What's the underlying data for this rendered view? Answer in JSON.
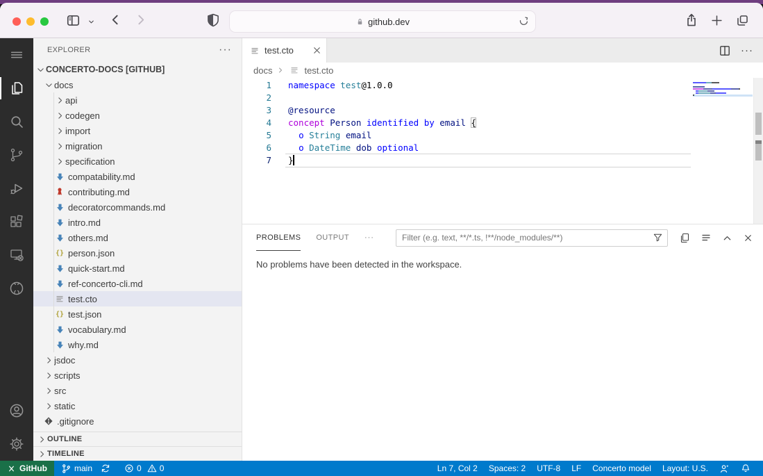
{
  "browser": {
    "url": "github.dev",
    "traffic_lights": [
      "close",
      "minimize",
      "zoom"
    ],
    "toolbar_icons": [
      "sidebar-toggle",
      "tab-overview-chevron",
      "back",
      "forward",
      "privacy-shield",
      "reload",
      "share",
      "new-tab",
      "tab-overview"
    ]
  },
  "activity_bar": {
    "items": [
      {
        "name": "menu",
        "icon": "menu"
      },
      {
        "name": "explorer",
        "icon": "files",
        "active": true
      },
      {
        "name": "search",
        "icon": "search"
      },
      {
        "name": "source-control",
        "icon": "scm"
      },
      {
        "name": "run-and-debug",
        "icon": "debug"
      },
      {
        "name": "extensions",
        "icon": "ext"
      },
      {
        "name": "remote-explorer",
        "icon": "remote"
      },
      {
        "name": "github",
        "icon": "github"
      }
    ],
    "bottom_items": [
      {
        "name": "account",
        "icon": "account"
      },
      {
        "name": "settings",
        "icon": "gear"
      }
    ]
  },
  "explorer": {
    "title": "EXPLORER",
    "root": "CONCERTO-DOCS [GITHUB]",
    "tree": [
      {
        "label": "docs",
        "kind": "folder",
        "level": 1,
        "expanded": true
      },
      {
        "label": "api",
        "kind": "folder",
        "level": 2
      },
      {
        "label": "codegen",
        "kind": "folder",
        "level": 2
      },
      {
        "label": "import",
        "kind": "folder",
        "level": 2
      },
      {
        "label": "migration",
        "kind": "folder",
        "level": 2
      },
      {
        "label": "specification",
        "kind": "folder",
        "level": 2
      },
      {
        "label": "compatability.md",
        "kind": "file",
        "icon": "md",
        "level": 2
      },
      {
        "label": "contributing.md",
        "kind": "file",
        "icon": "ribbon",
        "level": 2
      },
      {
        "label": "decoratorcommands.md",
        "kind": "file",
        "icon": "md",
        "level": 2
      },
      {
        "label": "intro.md",
        "kind": "file",
        "icon": "md",
        "level": 2
      },
      {
        "label": "others.md",
        "kind": "file",
        "icon": "md",
        "level": 2
      },
      {
        "label": "person.json",
        "kind": "file",
        "icon": "json",
        "level": 2
      },
      {
        "label": "quick-start.md",
        "kind": "file",
        "icon": "md",
        "level": 2
      },
      {
        "label": "ref-concerto-cli.md",
        "kind": "file",
        "icon": "md",
        "level": 2
      },
      {
        "label": "test.cto",
        "kind": "file",
        "icon": "filelines",
        "level": 2,
        "selected": true
      },
      {
        "label": "test.json",
        "kind": "file",
        "icon": "json",
        "level": 2
      },
      {
        "label": "vocabulary.md",
        "kind": "file",
        "icon": "md",
        "level": 2
      },
      {
        "label": "why.md",
        "kind": "file",
        "icon": "md",
        "level": 2
      },
      {
        "label": "jsdoc",
        "kind": "folder",
        "level": 1
      },
      {
        "label": "scripts",
        "kind": "folder",
        "level": 1
      },
      {
        "label": "src",
        "kind": "folder",
        "level": 1
      },
      {
        "label": "static",
        "kind": "folder",
        "level": 1
      },
      {
        "label": ".gitignore",
        "kind": "file",
        "icon": "git",
        "level": 1
      }
    ],
    "sections": [
      "OUTLINE",
      "TIMELINE"
    ]
  },
  "editor": {
    "tab": {
      "label": "test.cto"
    },
    "breadcrumbs": [
      "docs",
      "test.cto"
    ],
    "lines": [
      {
        "num": "1",
        "tokens": [
          {
            "t": "namespace ",
            "s": "kw"
          },
          {
            "t": "test",
            "s": "type"
          },
          {
            "t": "@1.0.0",
            "s": "pl"
          }
        ]
      },
      {
        "num": "2",
        "tokens": []
      },
      {
        "num": "3",
        "tokens": [
          {
            "t": "@resource",
            "s": "id"
          }
        ]
      },
      {
        "num": "4",
        "tokens": [
          {
            "t": "concept ",
            "s": "ctrl"
          },
          {
            "t": "Person ",
            "s": "id"
          },
          {
            "t": "identified by ",
            "s": "kw"
          },
          {
            "t": "email ",
            "s": "id"
          },
          {
            "t": "{",
            "s": "pl",
            "bracket": true
          }
        ]
      },
      {
        "num": "5",
        "tokens": [
          {
            "t": "  ",
            "s": "pl"
          },
          {
            "t": "o ",
            "s": "kw"
          },
          {
            "t": "String ",
            "s": "type"
          },
          {
            "t": "email",
            "s": "id"
          }
        ]
      },
      {
        "num": "6",
        "tokens": [
          {
            "t": "  ",
            "s": "pl"
          },
          {
            "t": "o ",
            "s": "kw"
          },
          {
            "t": "DateTime ",
            "s": "type"
          },
          {
            "t": "dob ",
            "s": "id"
          },
          {
            "t": "optional",
            "s": "kw"
          }
        ]
      },
      {
        "num": "7",
        "tokens": [
          {
            "t": "}",
            "s": "pl"
          }
        ],
        "current": true,
        "cursor": true
      }
    ]
  },
  "panel": {
    "tabs": [
      "PROBLEMS",
      "OUTPUT"
    ],
    "more_label": "···",
    "filter_placeholder": "Filter (e.g. text, **/*.ts, !**/node_modules/**)",
    "actions": [
      "copy",
      "list",
      "chevUp",
      "closeX"
    ],
    "message": "No problems have been detected in the workspace."
  },
  "status_bar": {
    "remote_label": "GitHub",
    "branch": "main",
    "errors": "0",
    "warnings": "0",
    "right_items": [
      "Ln 7, Col 2",
      "Spaces: 2",
      "UTF-8",
      "LF",
      "Concerto model",
      "Layout: U.S."
    ]
  },
  "colors": {
    "status_bar": "#007acc",
    "remote_badge": "#1a7048",
    "accent_selection": "#e4e6f1",
    "keyword": "#0000ff",
    "control": "#af00db",
    "type": "#267f99",
    "identifier": "#001080"
  }
}
